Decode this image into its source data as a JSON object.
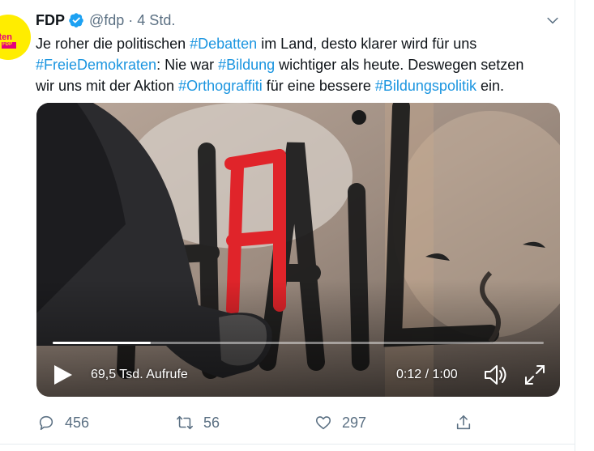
{
  "tweet": {
    "author_name": "FDP",
    "handle": "@fdp",
    "separator": "·",
    "time": "4 Std.",
    "avatar_text": "kraten",
    "avatar_badge": "FDP",
    "text_segments": [
      [
        {
          "t": "Je roher die politischen "
        },
        {
          "t": "#Debatten",
          "tag": true
        },
        {
          "t": " im Land, desto klarer wird für uns"
        }
      ],
      [
        {
          "t": "#FreieDemokraten",
          "tag": true
        },
        {
          "t": ": Nie war "
        },
        {
          "t": "#Bildung",
          "tag": true
        },
        {
          "t": " wichtiger als heute. Deswegen setzen"
        }
      ],
      [
        {
          "t": "wir uns mit der Aktion "
        },
        {
          "t": "#Orthograffiti",
          "tag": true
        },
        {
          "t": " für eine bessere "
        },
        {
          "t": "#Bildungspolitik",
          "tag": true
        },
        {
          "t": " ein."
        }
      ]
    ]
  },
  "video": {
    "views": "69,5 Tsd. Aufrufe",
    "time": "0:12 / 1:00",
    "progress": 0.2
  },
  "actions": {
    "replies": "456",
    "retweets": "56",
    "likes": "297"
  },
  "colors": {
    "link": "#1b95e0",
    "muted": "#5b7083",
    "verified": "#1da1f2",
    "graffiti_red": "#e0242a"
  }
}
